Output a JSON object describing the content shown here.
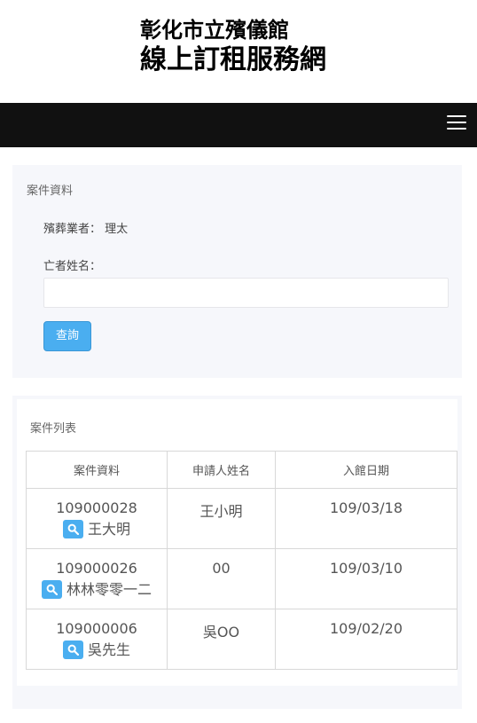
{
  "header": {
    "title_line1": "彰化市立殯儀館",
    "title_line2": "線上訂租服務網"
  },
  "navbar": {
    "menu_icon": "hamburger-menu-icon"
  },
  "case_info": {
    "title": "案件資料",
    "company_label": "殯葬業者：",
    "company_value": "理太",
    "deceased_label": "亡者姓名：",
    "deceased_value": "",
    "query_button": "查詢"
  },
  "case_list": {
    "title": "案件列表",
    "columns": [
      "案件資料",
      "申請人姓名",
      "入館日期"
    ],
    "rows": [
      {
        "case_no": "109000028",
        "name": "王大明",
        "applicant": "王小明",
        "date": "109/03/18"
      },
      {
        "case_no": "109000026",
        "name": "林林零零一二",
        "applicant": "00",
        "date": "109/03/10"
      },
      {
        "case_no": "109000006",
        "name": "吳先生",
        "applicant": "吳OO",
        "date": "109/02/20"
      }
    ]
  },
  "colors": {
    "navbar": "#111111",
    "accent": "#4aaef0",
    "panel_bg": "#f6f7fb"
  }
}
